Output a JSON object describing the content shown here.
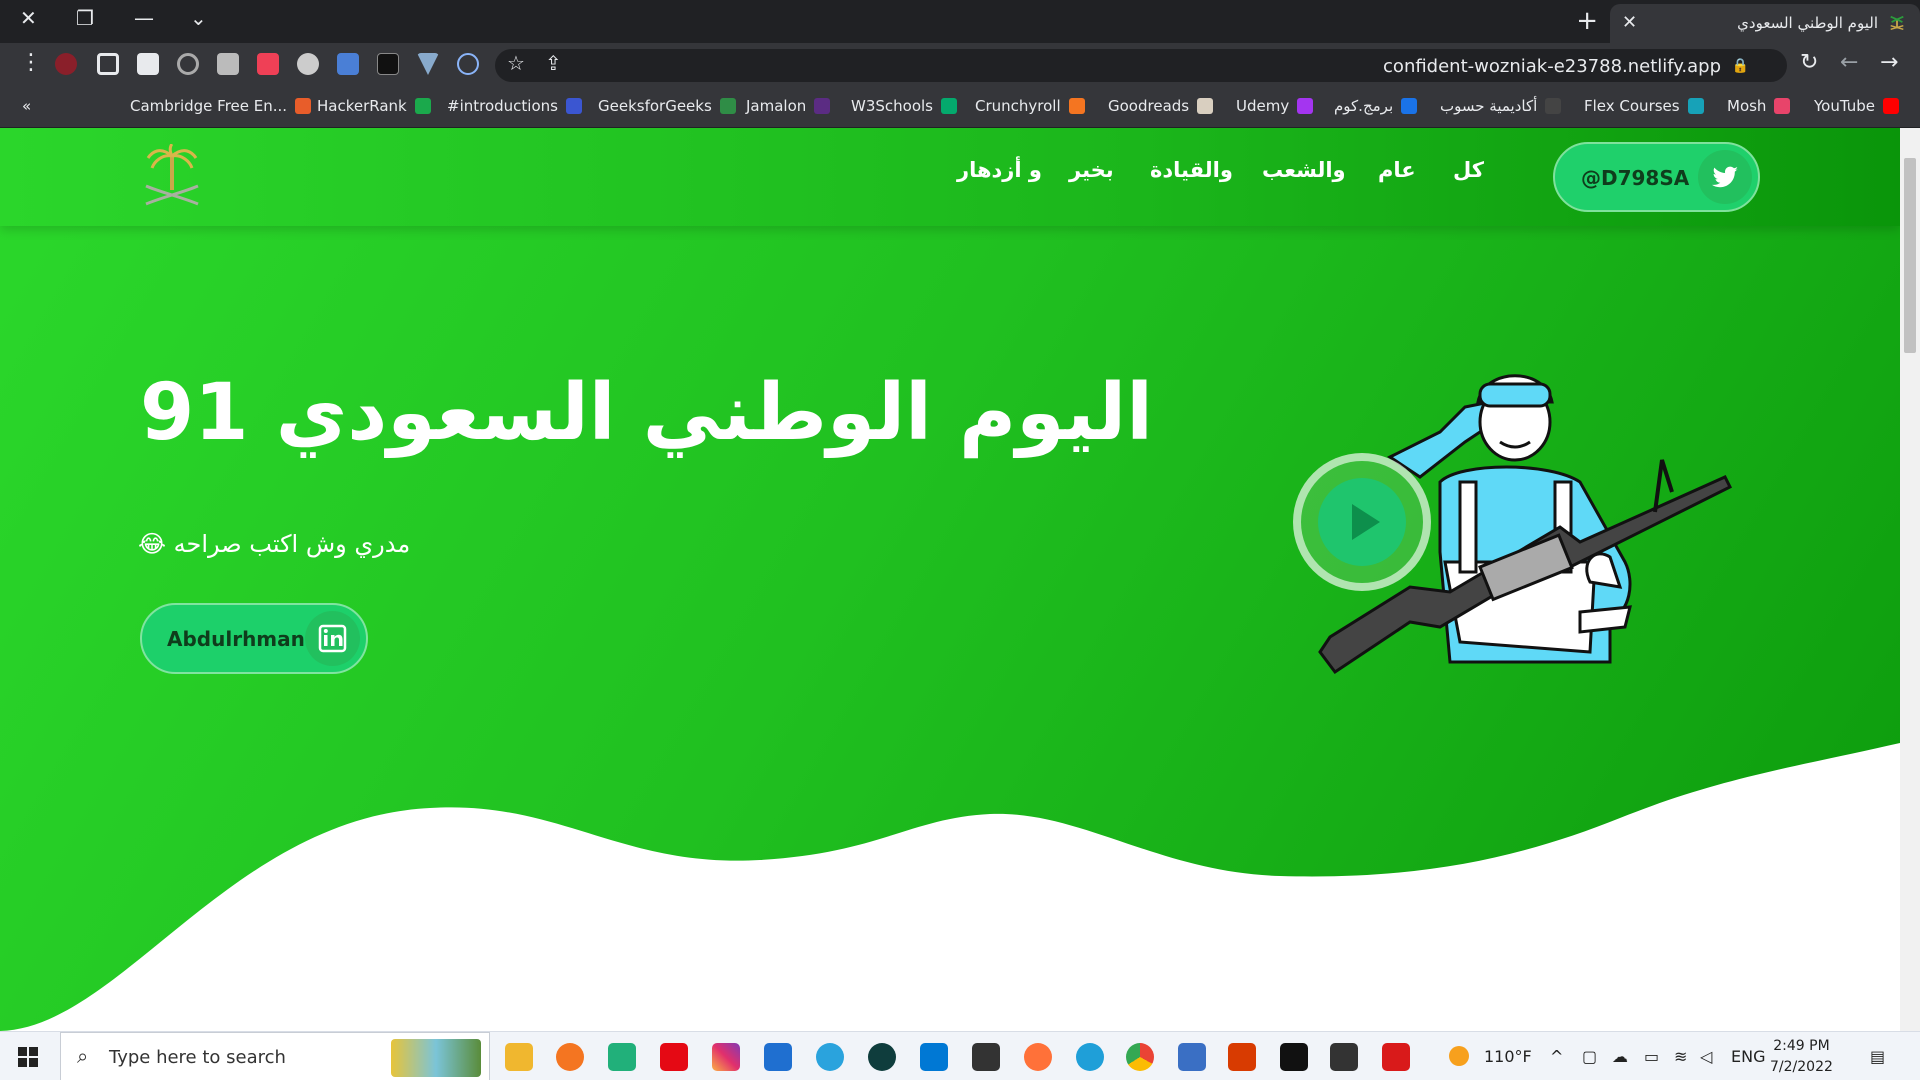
{
  "browser": {
    "tab_title": "اليوم الوطني السعودي",
    "url": "confident-wozniak-e23788.netlify.app",
    "bookmarks_toggle": "«",
    "bookmarks": [
      {
        "label": "Cambridge Free En...",
        "color": "#e85d2a"
      },
      {
        "label": "HackerRank",
        "color": "#1ba94c"
      },
      {
        "label": "#introductions",
        "color": "#3b56d1"
      },
      {
        "label": "GeeksforGeeks",
        "color": "#2f8d46"
      },
      {
        "label": "Jamalon",
        "color": "#5b2c83"
      },
      {
        "label": "W3Schools",
        "color": "#04aa6d"
      },
      {
        "label": "Crunchyroll",
        "color": "#f47521"
      },
      {
        "label": "Goodreads",
        "color": "#d9cfc0"
      },
      {
        "label": "Udemy",
        "color": "#a435f0"
      },
      {
        "label": "برمج.كوم",
        "color": "#1a73e8"
      },
      {
        "label": "أكاديمية حسوب",
        "color": "#444"
      },
      {
        "label": "Flex Courses",
        "color": "#17a2b8"
      },
      {
        "label": "Mosh",
        "color": "#e8446a"
      },
      {
        "label": "YouTube",
        "color": "#ff0000"
      }
    ]
  },
  "nav": {
    "links": [
      "كل",
      "عام",
      "والشعب",
      "والقيادة",
      "بخير",
      "و أزدهار"
    ],
    "twitter_handle": "@D798SA"
  },
  "hero": {
    "title": "اليوم الوطني السعودي 91",
    "subtitle": "مدري وش اكتب صراحه 😂",
    "linkedin_label": "Abdulrhman"
  },
  "taskbar": {
    "search_placeholder": "Type here to search",
    "weather": "110°F",
    "language": "ENG",
    "time": "2:49 PM",
    "date": "7/2/2022"
  },
  "colors": {
    "hero_green": "#20c020",
    "button_green": "#1dd06a",
    "brand_dark": "#0f3d1c"
  }
}
